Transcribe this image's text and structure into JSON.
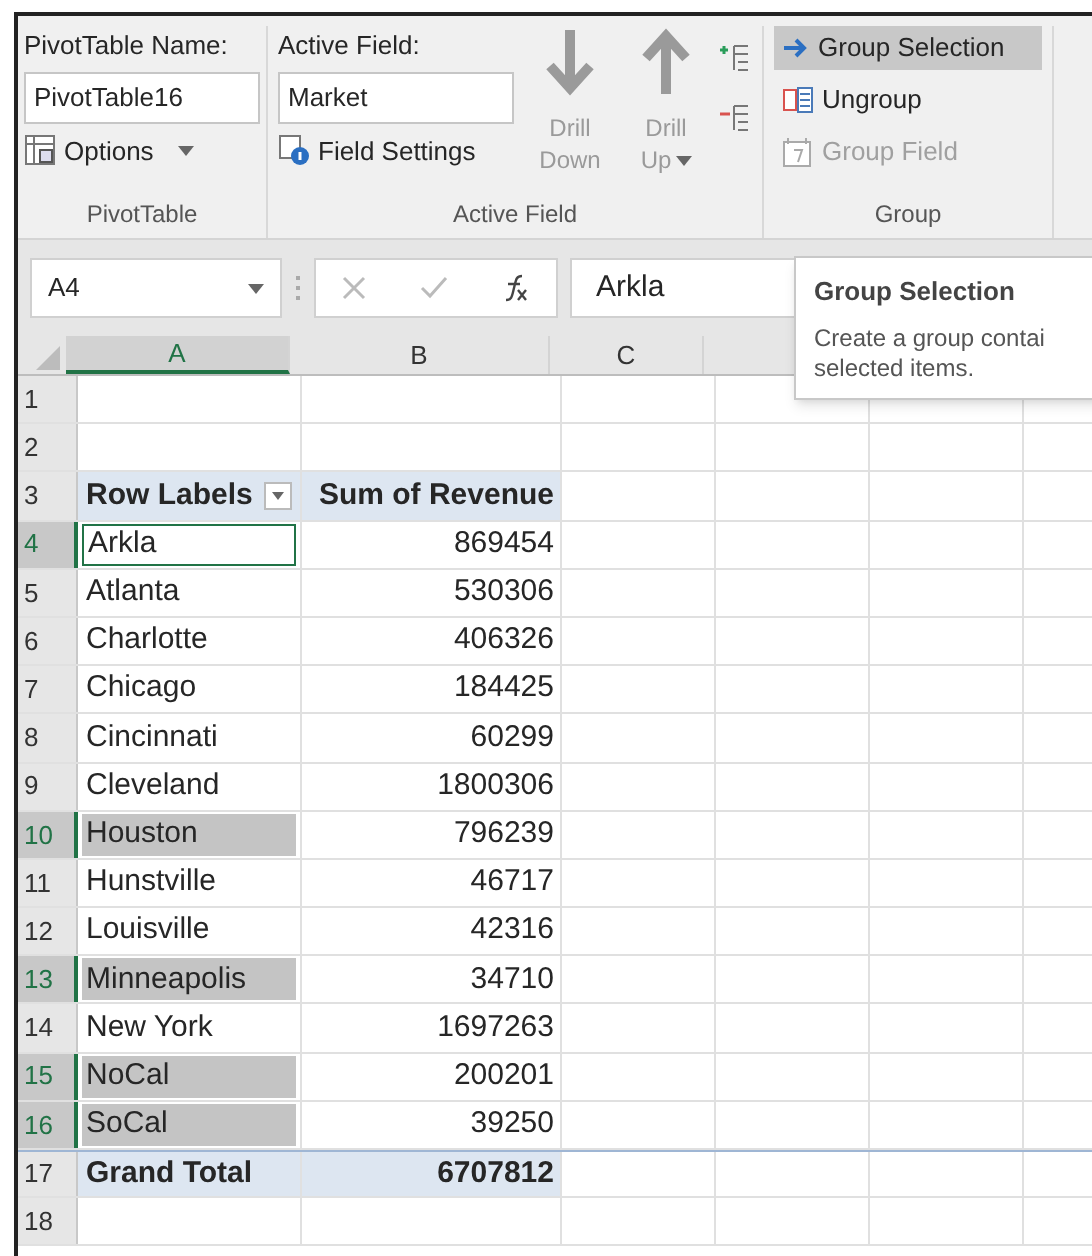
{
  "ribbon": {
    "pivottable": {
      "name_label": "PivotTable Name:",
      "name_value": "PivotTable16",
      "options": "Options",
      "group_label": "PivotTable"
    },
    "active_field": {
      "label": "Active Field:",
      "value": "Market",
      "field_settings": "Field Settings",
      "drill_down": [
        "Drill",
        "Down"
      ],
      "drill_up": [
        "Drill",
        "Up"
      ],
      "group_label": "Active Field"
    },
    "group": {
      "items": [
        {
          "kind": "group",
          "label": "Group Selection",
          "selected": true,
          "disabled": false
        },
        {
          "kind": "ungroup",
          "label": "Ungroup",
          "selected": false,
          "disabled": false
        },
        {
          "kind": "field",
          "label": "Group Field",
          "selected": false,
          "disabled": true
        }
      ],
      "group_label": "Group"
    }
  },
  "formula_bar": {
    "name_box": "A4",
    "value": "Arkla"
  },
  "tooltip": {
    "title": "Group Selection",
    "text": "Create a group contai\nselected items."
  },
  "columns": [
    "A",
    "B",
    "C"
  ],
  "rows": [
    {
      "number": "1",
      "kind": "empty",
      "selected": false,
      "active": false
    },
    {
      "number": "2",
      "kind": "empty",
      "selected": false,
      "active": false
    },
    {
      "number": "3",
      "kind": "header",
      "label": "Row Labels",
      "value": "Sum of Revenue",
      "selected": false,
      "active": false
    },
    {
      "number": "4",
      "kind": "item",
      "label": "Arkla",
      "value": "869454",
      "selected": true,
      "active": true
    },
    {
      "number": "5",
      "kind": "item",
      "label": "Atlanta",
      "value": "530306",
      "selected": false,
      "active": false
    },
    {
      "number": "6",
      "kind": "item",
      "label": "Charlotte",
      "value": "406326",
      "selected": false,
      "active": false
    },
    {
      "number": "7",
      "kind": "item",
      "label": "Chicago",
      "value": "184425",
      "selected": false,
      "active": false
    },
    {
      "number": "8",
      "kind": "item",
      "label": "Cincinnati",
      "value": "60299",
      "selected": false,
      "active": false
    },
    {
      "number": "9",
      "kind": "item",
      "label": "Cleveland",
      "value": "1800306",
      "selected": false,
      "active": false
    },
    {
      "number": "10",
      "kind": "item",
      "label": "Houston",
      "value": "796239",
      "selected": true,
      "active": false
    },
    {
      "number": "11",
      "kind": "item",
      "label": "Hunstville",
      "value": "46717",
      "selected": false,
      "active": false
    },
    {
      "number": "12",
      "kind": "item",
      "label": "Louisville",
      "value": "42316",
      "selected": false,
      "active": false
    },
    {
      "number": "13",
      "kind": "item",
      "label": "Minneapolis",
      "value": "34710",
      "selected": true,
      "active": false
    },
    {
      "number": "14",
      "kind": "item",
      "label": "New York",
      "value": "1697263",
      "selected": false,
      "active": false
    },
    {
      "number": "15",
      "kind": "item",
      "label": "NoCal",
      "value": "200201",
      "selected": true,
      "active": false
    },
    {
      "number": "16",
      "kind": "item",
      "label": "SoCal",
      "value": "39250",
      "selected": true,
      "active": false
    },
    {
      "number": "17",
      "kind": "total",
      "label": "Grand Total",
      "value": "6707812",
      "selected": false,
      "active": false
    },
    {
      "number": "18",
      "kind": "empty",
      "selected": false,
      "active": false
    }
  ]
}
